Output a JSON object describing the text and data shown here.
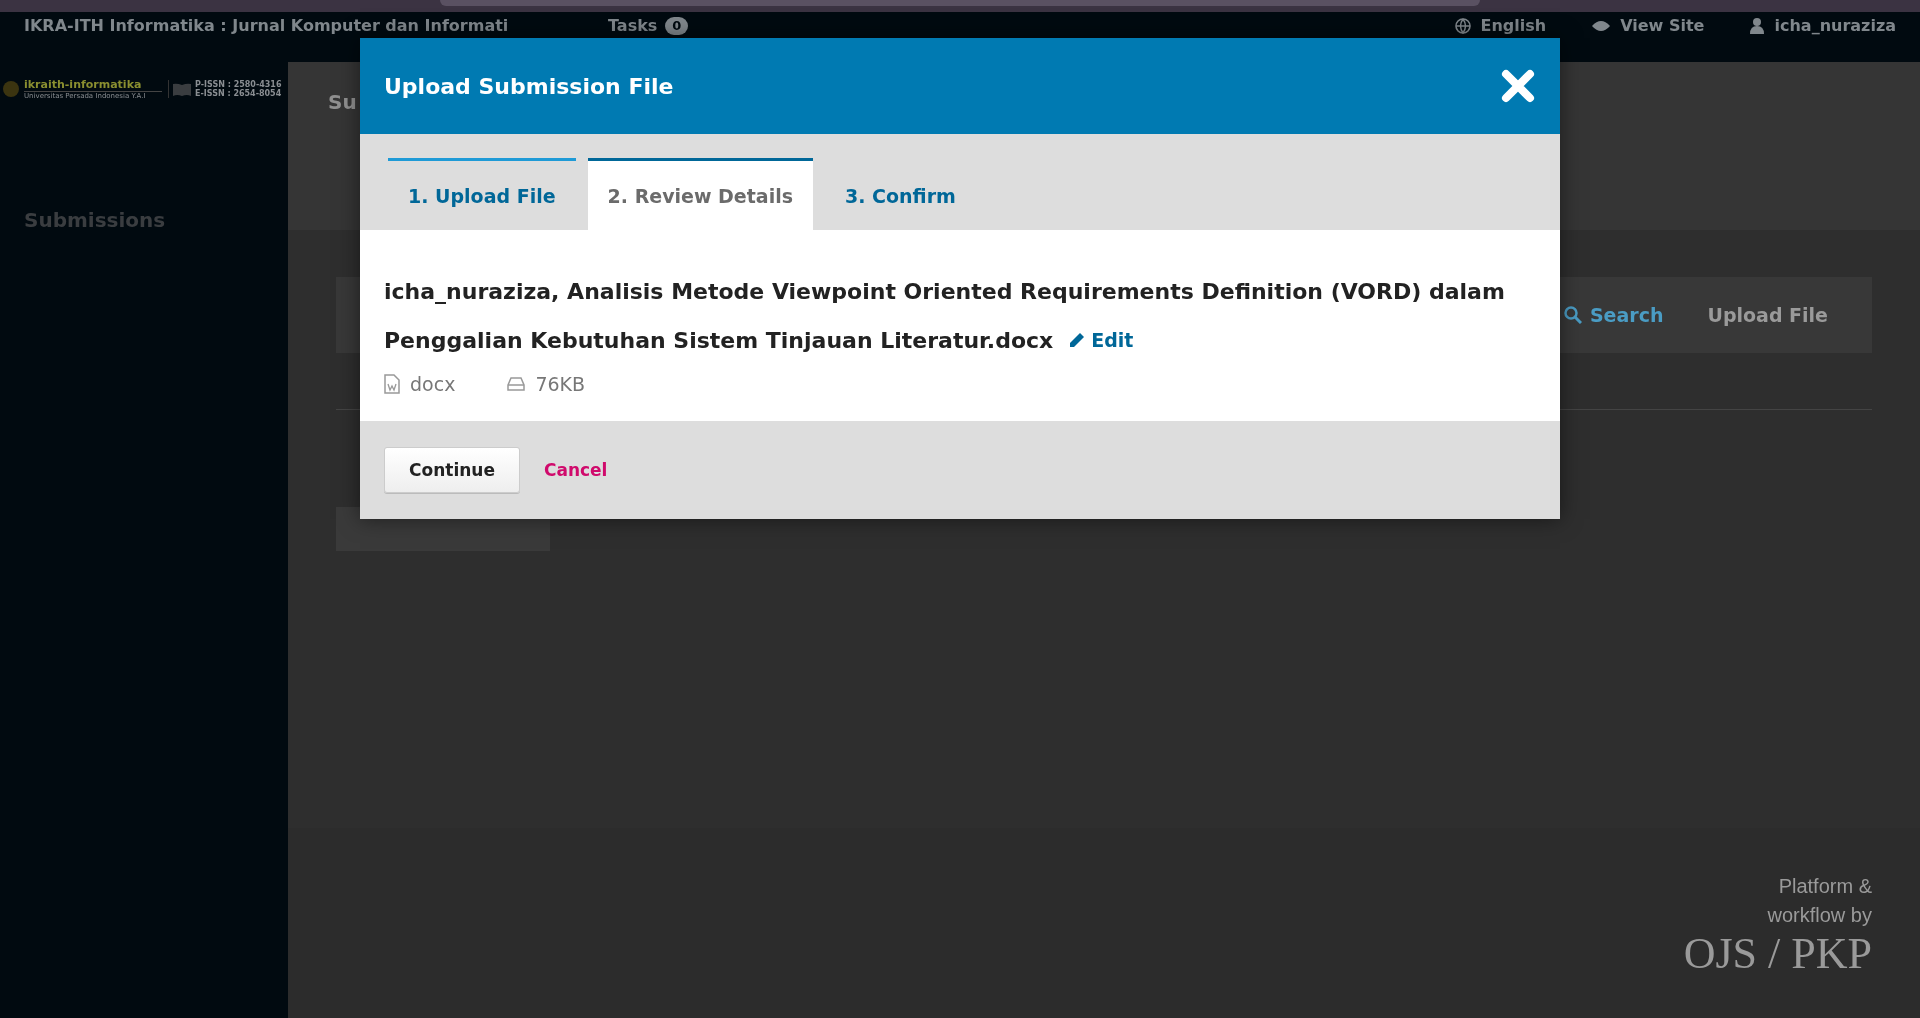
{
  "header": {
    "journal_title": "IKRA-ITH Informatika : Jurnal Komputer dan Informati",
    "tasks": {
      "label": "Tasks",
      "count": "0"
    },
    "language": "English",
    "view_site": "View Site",
    "user": "icha_nuraziza"
  },
  "sidebar": {
    "logo": {
      "name": "ikraith-informatika",
      "subtitle": "Universitas Persada Indonesia Y.A.I",
      "issn": [
        "P-ISSN : 2580-4316",
        "E-ISSN : 2654-8054"
      ]
    },
    "items": [
      {
        "label": "Submissions"
      }
    ]
  },
  "page": {
    "title_fragment": "Su",
    "files_panel": {
      "actions": [
        "Search",
        "Upload File"
      ]
    }
  },
  "modal": {
    "title": "Upload Submission File",
    "tabs": [
      {
        "label": "1. Upload File",
        "selected": false,
        "done": true
      },
      {
        "label": "2. Review Details",
        "selected": true,
        "done": false
      },
      {
        "label": "3. Confirm",
        "selected": false,
        "done": false
      }
    ],
    "file": {
      "name": "icha_nuraziza, Analisis Metode Viewpoint Oriented Requirements Definition (VORD) dalam Penggalian Kebutuhan Sistem Tinjauan Literatur.docx",
      "edit": "Edit",
      "type": "docx",
      "size": "76KB"
    },
    "buttons": {
      "continue": "Continue",
      "cancel": "Cancel"
    }
  },
  "footer": {
    "credit": [
      "Platform &",
      "workflow by"
    ],
    "logo": "OJS / PKP"
  }
}
